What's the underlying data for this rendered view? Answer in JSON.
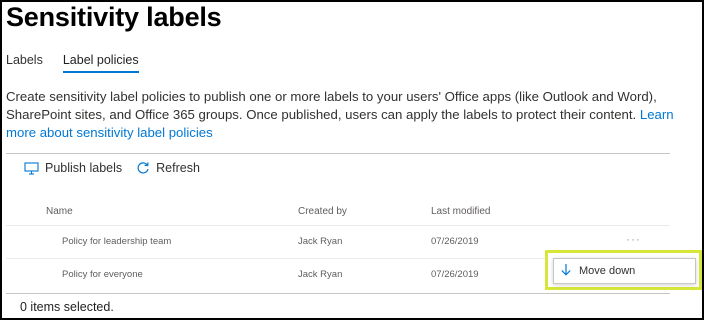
{
  "page": {
    "title": "Sensitivity labels"
  },
  "tabs": [
    {
      "label": "Labels",
      "active": false
    },
    {
      "label": "Label policies",
      "active": true
    }
  ],
  "description": {
    "text": "Create sensitivity label policies to publish one or more labels to your users' Office apps (like Outlook and Word), SharePoint sites, and Office 365 groups. Once published, users can apply the labels to protect their content. ",
    "link": "Learn more about sensitivity label policies"
  },
  "toolbar": {
    "publish_label": "Publish labels",
    "publish_icon": "publish-icon",
    "refresh_label": "Refresh",
    "refresh_icon": "refresh-icon"
  },
  "table": {
    "columns": [
      "Name",
      "Created by",
      "Last modified"
    ],
    "rows": [
      {
        "name": "Policy for leadership team",
        "created_by": "Jack Ryan",
        "last_modified": "07/26/2019"
      },
      {
        "name": "Policy for everyone",
        "created_by": "Jack Ryan",
        "last_modified": "07/26/2019"
      }
    ],
    "more_actions": "···"
  },
  "context_menu": {
    "item_label": "Move down",
    "item_icon": "arrow-down-icon"
  },
  "footer": {
    "selection_text": "0 items selected."
  },
  "colors": {
    "accent": "#0078d4",
    "highlight": "#d6e73a"
  }
}
